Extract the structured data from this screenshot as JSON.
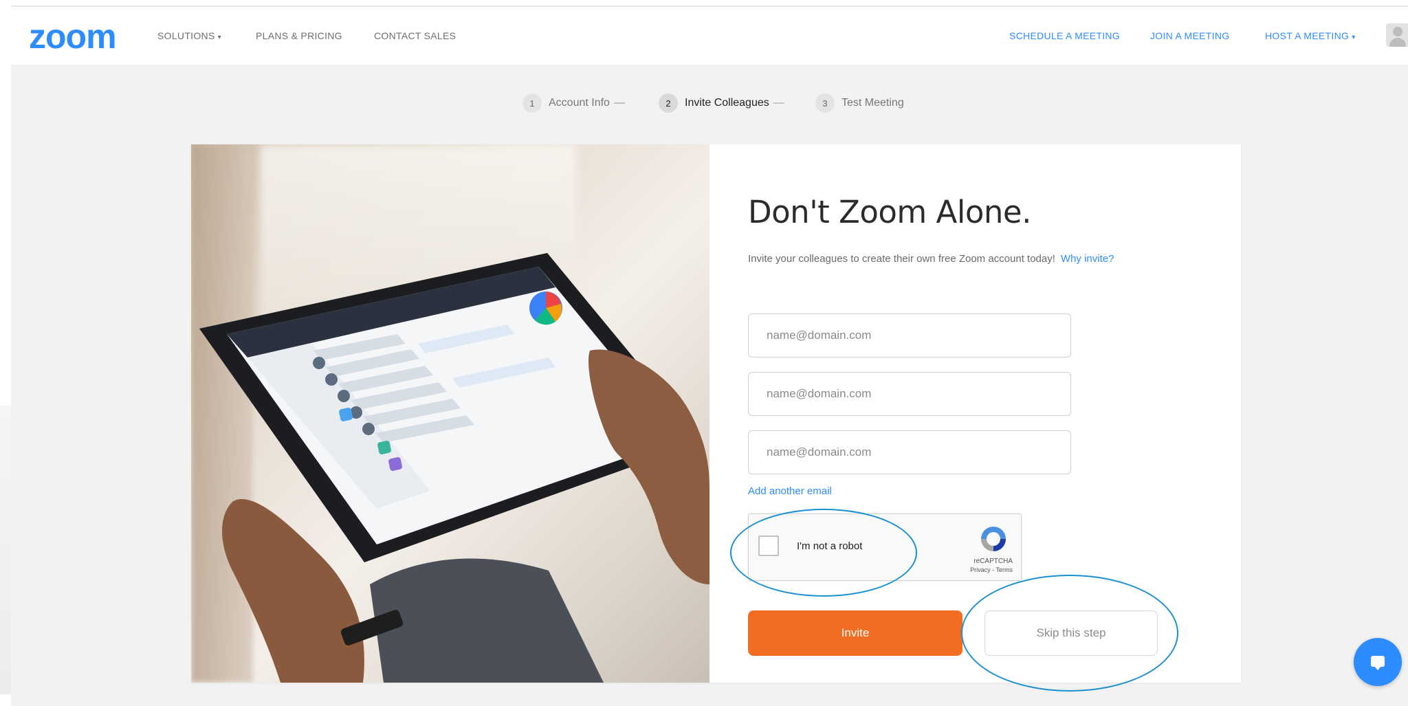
{
  "header": {
    "logo": "zoom",
    "nav_left": [
      "SOLUTIONS",
      "PLANS & PRICING",
      "CONTACT SALES"
    ],
    "nav_right": [
      "SCHEDULE A MEETING",
      "JOIN A MEETING",
      "HOST A MEETING"
    ],
    "caret": "▾"
  },
  "steps": [
    {
      "num": "1",
      "label": "Account Info",
      "dash": "—"
    },
    {
      "num": "2",
      "label": "Invite Colleagues",
      "dash": "—"
    },
    {
      "num": "3",
      "label": "Test Meeting",
      "dash": ""
    }
  ],
  "main": {
    "title": "Don't Zoom Alone.",
    "subtitle": "Invite your colleagues to create their own free Zoom account today!",
    "why_link": "Why invite?",
    "email_placeholder": "name@domain.com",
    "add_email": "Add another email",
    "invite_button": "Invite",
    "skip_button": "Skip this step"
  },
  "recaptcha": {
    "label": "I'm not a robot",
    "brand": "reCAPTCHA",
    "links": "Privacy - Terms"
  },
  "colors": {
    "brand_blue": "#2D8CFF",
    "invite_orange": "#F26D21",
    "annotation_blue": "#1a8fd1"
  },
  "icons": [
    "user-avatar-icon",
    "recaptcha-logo-icon",
    "chat-icon",
    "chevron-down-icon"
  ]
}
